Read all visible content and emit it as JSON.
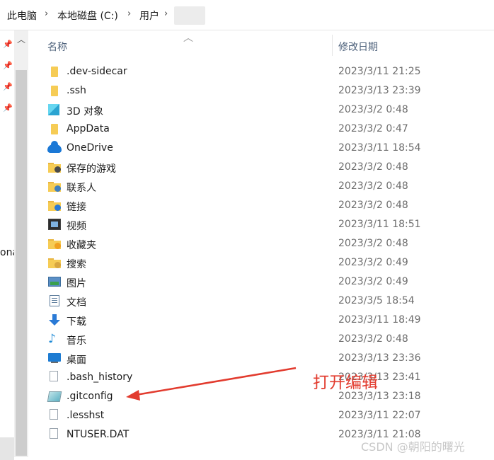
{
  "breadcrumb": {
    "items": [
      "此电脑",
      "本地磁盘 (C:)",
      "用户"
    ],
    "separator": "›"
  },
  "nav_pane": {
    "partial_label": "ona"
  },
  "columns": {
    "name": "名称",
    "date_modified": "修改日期"
  },
  "files": [
    {
      "name": ".dev-sidecar",
      "date": "2023/3/11 21:25",
      "icon": "folder-icon"
    },
    {
      "name": ".ssh",
      "date": "2023/3/13 23:39",
      "icon": "folder-icon"
    },
    {
      "name": "3D 对象",
      "date": "2023/3/2 0:48",
      "icon": "3d-objects-icon"
    },
    {
      "name": "AppData",
      "date": "2023/3/2 0:47",
      "icon": "folder-icon"
    },
    {
      "name": "OneDrive",
      "date": "2023/3/11 18:54",
      "icon": "onedrive-cloud-icon"
    },
    {
      "name": "保存的游戏",
      "date": "2023/3/2 0:48",
      "icon": "saved-games-icon"
    },
    {
      "name": "联系人",
      "date": "2023/3/2 0:48",
      "icon": "contacts-icon"
    },
    {
      "name": "链接",
      "date": "2023/3/2 0:48",
      "icon": "links-icon"
    },
    {
      "name": "视频",
      "date": "2023/3/11 18:51",
      "icon": "video-icon"
    },
    {
      "name": "收藏夹",
      "date": "2023/3/2 0:48",
      "icon": "favorites-icon"
    },
    {
      "name": "搜索",
      "date": "2023/3/2 0:49",
      "icon": "searches-icon"
    },
    {
      "name": "图片",
      "date": "2023/3/2 0:49",
      "icon": "pictures-icon"
    },
    {
      "name": "文档",
      "date": "2023/3/5 18:54",
      "icon": "documents-icon"
    },
    {
      "name": "下载",
      "date": "2023/3/11 18:49",
      "icon": "download-icon"
    },
    {
      "name": "音乐",
      "date": "2023/3/2 0:48",
      "icon": "music-icon"
    },
    {
      "name": "桌面",
      "date": "2023/3/13 23:36",
      "icon": "desktop-icon"
    },
    {
      "name": ".bash_history",
      "date": "2023/3/13 23:41",
      "icon": "file-icon"
    },
    {
      "name": ".gitconfig",
      "date": "2023/3/13 23:18",
      "icon": "config-file-icon"
    },
    {
      "name": ".lesshst",
      "date": "2023/3/11 22:07",
      "icon": "file-icon"
    },
    {
      "name": "NTUSER.DAT",
      "date": "2023/3/11 21:08",
      "icon": "file-icon"
    }
  ],
  "annotation": {
    "text": "打开编辑",
    "color": "#e23b2e"
  },
  "watermark": "CSDN @朝阳的曙光",
  "colors": {
    "header_text": "#4c607a",
    "date_text": "#6d6d6d",
    "folder": "#f6cc55",
    "annotation_red": "#e23b2e"
  }
}
